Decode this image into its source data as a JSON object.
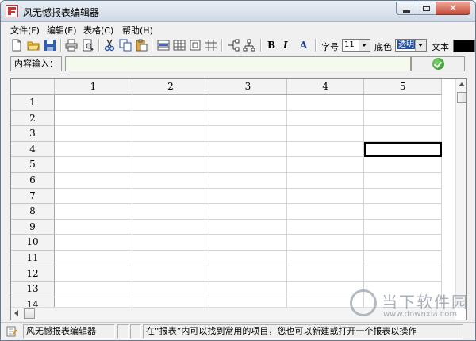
{
  "window": {
    "title": "风无憾报表编辑器"
  },
  "menu": [
    {
      "label": "文件(F)"
    },
    {
      "label": "编辑(E)"
    },
    {
      "label": "表格(C)"
    },
    {
      "label": "帮助(H)"
    }
  ],
  "toolbar": {
    "bold_label": "B",
    "italic_label": "I",
    "color_label": "A",
    "font_size_label": "字号",
    "font_size_value": "11",
    "bg_label": "底色",
    "bg_value": "透明",
    "text_label": "文本",
    "text_color": "#000000"
  },
  "input_bar": {
    "label": "内容输入：",
    "value": ""
  },
  "grid": {
    "columns": [
      "1",
      "2",
      "3",
      "4",
      "5"
    ],
    "rows": [
      "1",
      "2",
      "3",
      "4",
      "5",
      "6",
      "7",
      "8",
      "9",
      "10",
      "11",
      "12",
      "13",
      "14"
    ],
    "selected_cell": {
      "row": "4",
      "column": "5"
    }
  },
  "status_bar": {
    "app_name": "风无憾报表编辑器",
    "message": "在“报表”内可以找到常用的项目，您也可以新建或打开一个报表以操作"
  },
  "watermark": {
    "text": "当下软件园",
    "url_text": "www.downxia.com"
  }
}
